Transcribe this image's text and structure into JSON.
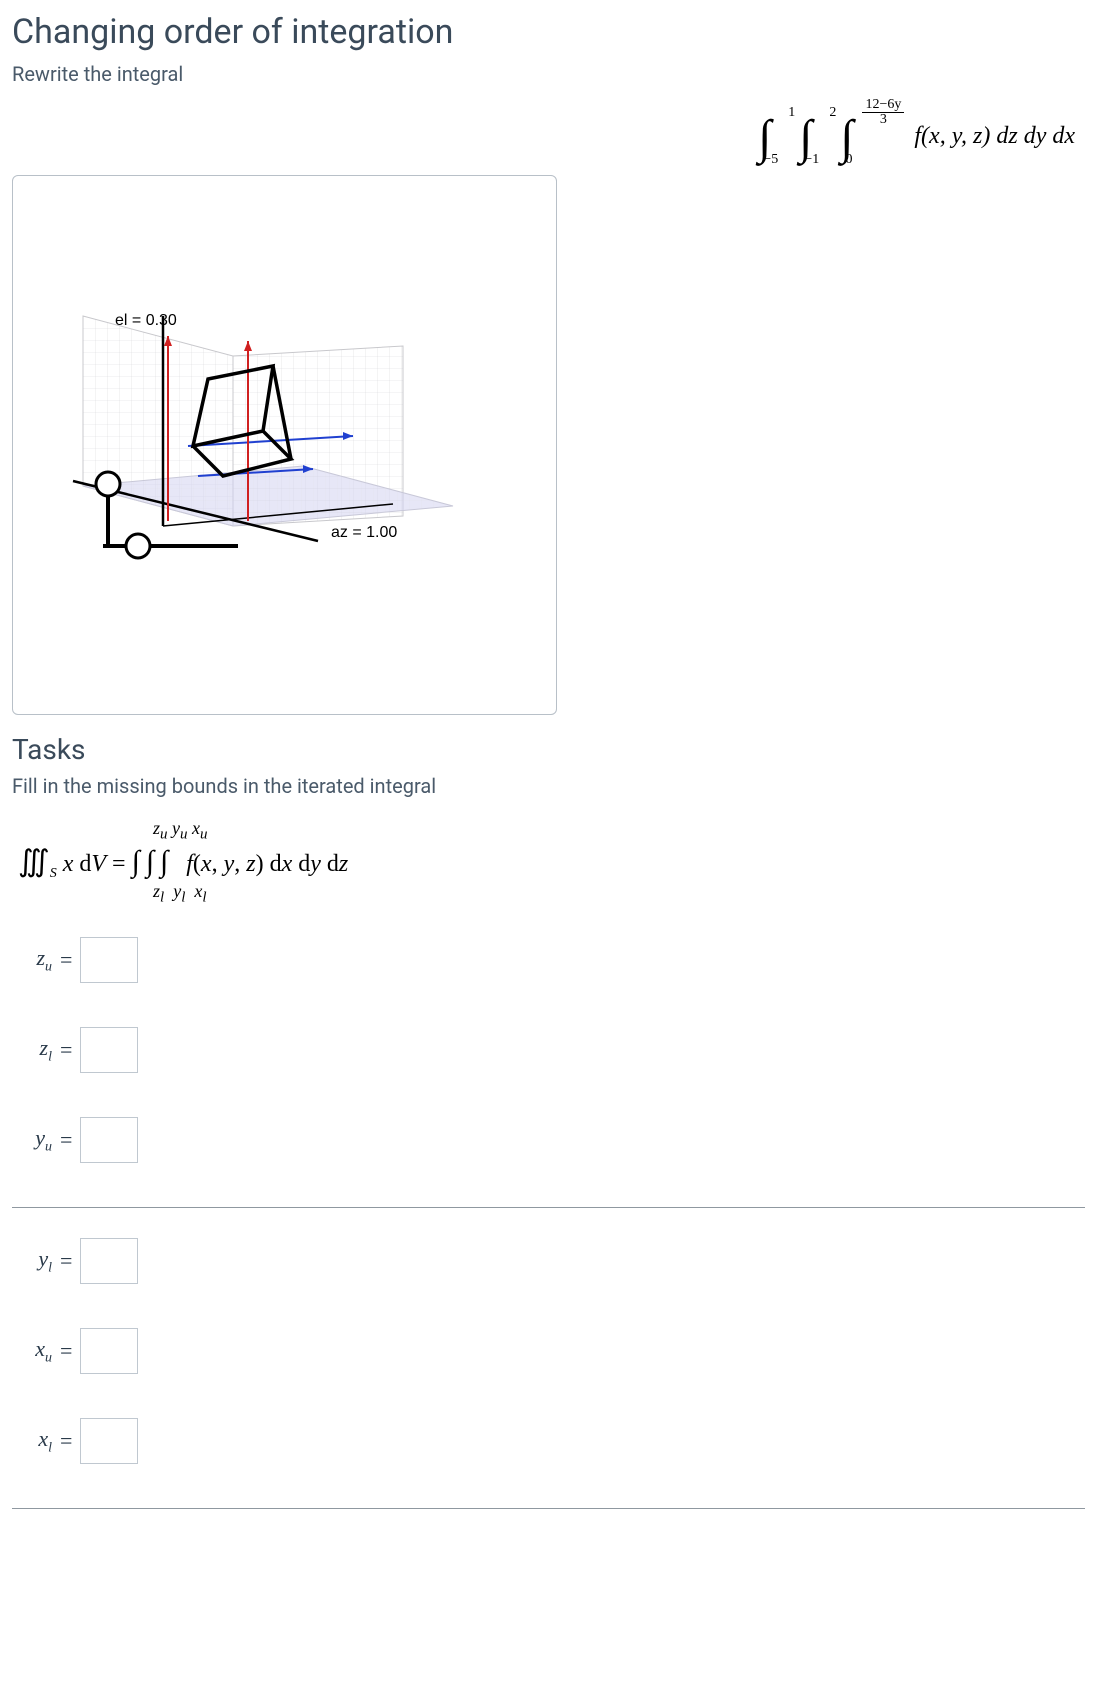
{
  "title": "Changing order of integration",
  "subtitle": "Rewrite the integral",
  "integral": {
    "outer_lower": "−5",
    "outer_upper": "1",
    "middle_lower": "−1",
    "middle_upper": "2",
    "inner_lower": "0",
    "inner_upper_num": "12−6y",
    "inner_upper_den": "3",
    "integrand": "f(x, y, z) dz dy dx"
  },
  "graph": {
    "el_label": "el = 0.30",
    "az_label": "az = 1.00"
  },
  "tasks": {
    "heading": "Tasks",
    "instruction": "Fill in the missing bounds in the iterated integral",
    "upper_vars": "zᵤ yᵤ xᵤ",
    "lhs": "∭ₛ x dV = ∫ ∫ ∫  f(x, y, z) dx dy dz",
    "lower_vars": "zₗ yₗ xₗ"
  },
  "inputs": {
    "zu": {
      "label": "zᵤ",
      "value": ""
    },
    "zl": {
      "label": "zₗ",
      "value": ""
    },
    "yu": {
      "label": "yᵤ",
      "value": ""
    },
    "yl": {
      "label": "yₗ",
      "value": ""
    },
    "xu": {
      "label": "xᵤ",
      "value": ""
    },
    "xl": {
      "label": "xₗ",
      "value": ""
    }
  }
}
